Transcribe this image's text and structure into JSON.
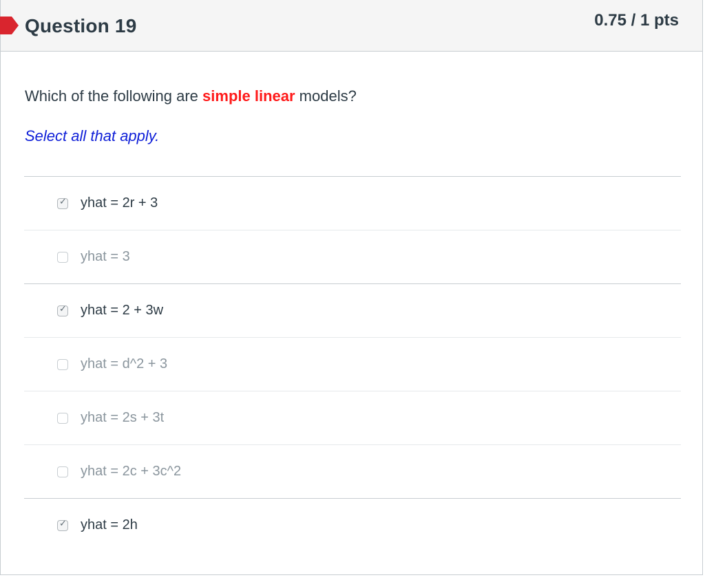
{
  "question": {
    "title": "Question 19",
    "points": "0.75 / 1 pts",
    "text_before": "Which of the following are ",
    "text_emphasis": "simple linear",
    "text_after": " models?",
    "instruction": "Select all that apply."
  },
  "answers": [
    {
      "label": "yhat = 2r + 3",
      "checked": true
    },
    {
      "label": "yhat = 3",
      "checked": false
    },
    {
      "label": "yhat = 2 + 3w",
      "checked": true
    },
    {
      "label": "yhat = d^2 + 3",
      "checked": false
    },
    {
      "label": "yhat = 2s + 3t",
      "checked": false
    },
    {
      "label": "yhat = 2c + 3c^2",
      "checked": false
    },
    {
      "label": "yhat = 2h",
      "checked": true
    }
  ],
  "colors": {
    "flag": "#d9252e",
    "emphasis": "#ff1a1a",
    "instruction": "#1020d8"
  },
  "icons": {
    "flag": "flag-marker-icon",
    "check": "checkmark-icon"
  }
}
